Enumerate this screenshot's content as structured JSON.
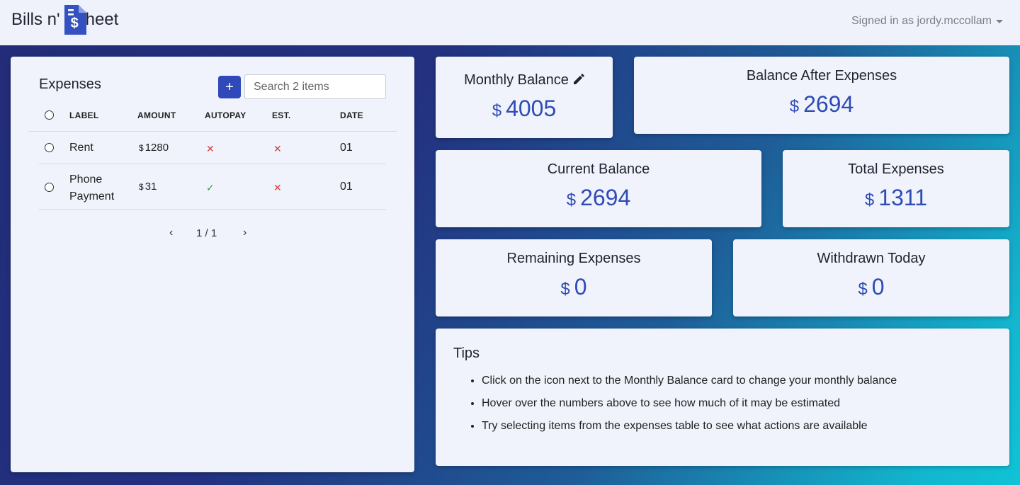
{
  "brand": {
    "part1": "Bills n'",
    "part2": "heet",
    "logo_glyph": "$",
    "icon": "document-dollar-icon"
  },
  "user": {
    "label": "Signed in as jordy.mccollam"
  },
  "expenses": {
    "title": "Expenses",
    "add_label": "+",
    "search_placeholder": "Search 2 items",
    "columns": [
      "LABEL",
      "AMOUNT",
      "AUTOPAY",
      "EST.",
      "DATE"
    ],
    "rows": [
      {
        "label": "Rent",
        "currency": "$",
        "amount": "1280",
        "autopay": false,
        "estimated": false,
        "date": "01"
      },
      {
        "label_line1": "Phone",
        "label_line2": "Payment",
        "currency": "$",
        "amount": "31",
        "autopay": true,
        "estimated": false,
        "date": "01"
      }
    ],
    "pager": {
      "prev": "‹",
      "text": "1 / 1",
      "next": "›"
    },
    "marks": {
      "yes": "✓",
      "no": "✕"
    }
  },
  "stats": {
    "monthly_balance": {
      "title": "Monthly Balance",
      "currency": "$",
      "value": "4005"
    },
    "balance_after": {
      "title": "Balance After Expenses",
      "currency": "$",
      "value": "2694"
    },
    "current_balance": {
      "title": "Current Balance",
      "currency": "$",
      "value": "2694"
    },
    "total_expenses": {
      "title": "Total Expenses",
      "currency": "$",
      "value": "1311"
    },
    "remaining_expenses": {
      "title": "Remaining Expenses",
      "currency": "$",
      "value": "0"
    },
    "withdrawn_today": {
      "title": "Withdrawn Today",
      "currency": "$",
      "value": "0"
    }
  },
  "tips": {
    "title": "Tips",
    "items": [
      "Click on the icon next to the Monthly Balance card to change your monthly balance",
      "Hover over the numbers above to see how much of it may be estimated",
      "Try selecting items from the expenses table to see what actions are available"
    ]
  },
  "colors": {
    "accent": "#2f4bb5",
    "button": "#2f49b8",
    "no": "#d63b3b",
    "yes": "#2e9a4a"
  }
}
